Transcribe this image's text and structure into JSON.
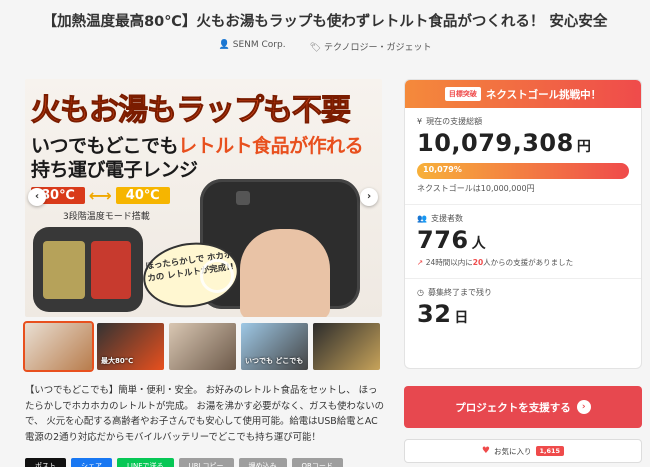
{
  "page": {
    "title": "【加熱温度最高80℃】火もお湯もラップも使わずレトルト食品がつくれる！ 安心安全",
    "author": "SENM Corp.",
    "category": "テクノロジー・ガジェット"
  },
  "hero": {
    "headline": "火もお湯もラップも不要",
    "line2_a": "いつでもどこでも",
    "line2_b": "レトルト食品が作れる",
    "line3": "持ち運び電子レンジ",
    "temp_high": "80℃",
    "temp_low": "40℃",
    "mode": "3段階温度モード搭載",
    "bubble": "ほったらかしで ホカホカの レトルトが完成!!"
  },
  "thumbnails": [
    {
      "label": ""
    },
    {
      "label": "最大80℃"
    },
    {
      "label": ""
    },
    {
      "label": "いつでも どこでも"
    },
    {
      "label": ""
    }
  ],
  "description": "【いつでもどこでも】簡単・便利・安全。 お好みのレトルト食品をセットし、 ほったらかしでホカホカのレトルトが完成。 お湯を沸かす必要がなく、ガスも使わないので、 火元を心配する高齢者やお子さんでも安心して使用可能。給電はUSB給電とAC電源の2通り対応だからモバイルバッテリーでどこでも持ち運び可能！",
  "share": [
    {
      "label": "ポスト",
      "color": "#111111"
    },
    {
      "label": "シェア",
      "color": "#1877f2"
    },
    {
      "label": "LINEで送る",
      "color": "#06c755"
    },
    {
      "label": "URLコピー",
      "color": "#9e9e9e"
    },
    {
      "label": "埋め込み",
      "color": "#9e9e9e"
    },
    {
      "label": "QRコード",
      "color": "#9e9e9e"
    }
  ],
  "funding": {
    "badge": "目標突破",
    "banner": "ネクストゴール挑戦中！",
    "raised_label": "現在の支援総額",
    "raised_value": "10,079,308",
    "raised_unit": "円",
    "progress_text": "10,079%",
    "next_goal": "ネクストゴールは10,000,000円",
    "backers_label": "支援者数",
    "backers_value": "776",
    "backers_unit": "人",
    "recent_prefix": "24時間以内に",
    "recent_count": "20",
    "recent_suffix": "人からの支援がありました",
    "remaining_label": "募集終了まで残り",
    "remaining_value": "32",
    "remaining_unit": "日"
  },
  "cta": {
    "support": "プロジェクトを支援する",
    "favorite": "お気に入り",
    "favorite_count": "1,615"
  },
  "colors": {
    "accent": "#ef4b4b",
    "orange": "#f48a3b"
  }
}
